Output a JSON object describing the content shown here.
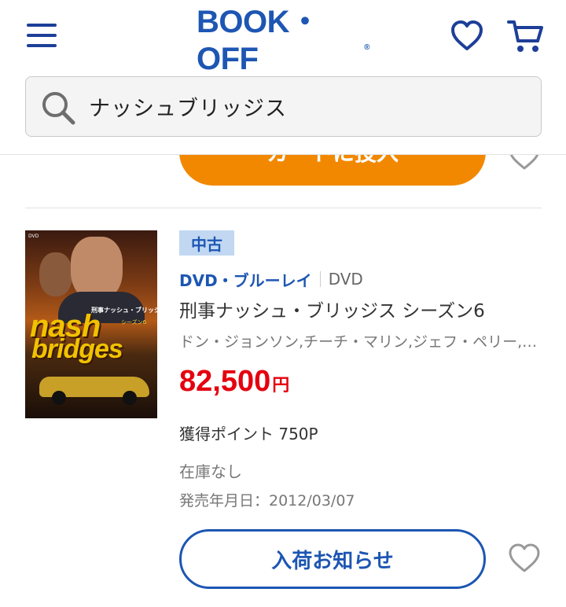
{
  "header": {
    "logo_text": "BOOK・OFF",
    "logo_reg": "®",
    "brand_color": "#1d56b3",
    "icons": [
      "hamburger-menu-icon",
      "heart-icon",
      "cart-icon"
    ]
  },
  "search": {
    "value": "ナッシュブリッジス",
    "icon": "search-icon"
  },
  "prev_item": {
    "cart_button_label": "カートに投入",
    "cart_button_color": "#f28800"
  },
  "product": {
    "condition_badge": "中古",
    "category": "DVD・ブルーレイ",
    "format": "DVD",
    "title": "刑事ナッシュ・ブリッジス シーズン6",
    "cast": "ドン・ジョンソン,チーチ・マリン,ジェフ・ペリー,ジョディ・ライオンズ",
    "price": "82,500",
    "price_unit": "円",
    "price_color": "#e4000f",
    "points": "獲得ポイント 750P",
    "stock": "在庫なし",
    "release": "発売年月日：2012/03/07",
    "notify_button_label": "入荷お知らせ",
    "cover": {
      "line1": "nash",
      "line2": "bridges",
      "jp_title": "刑事ナッシュ・ブリッジス",
      "jp_sub": "シーズン6",
      "dvd_mark": "DVD"
    }
  }
}
